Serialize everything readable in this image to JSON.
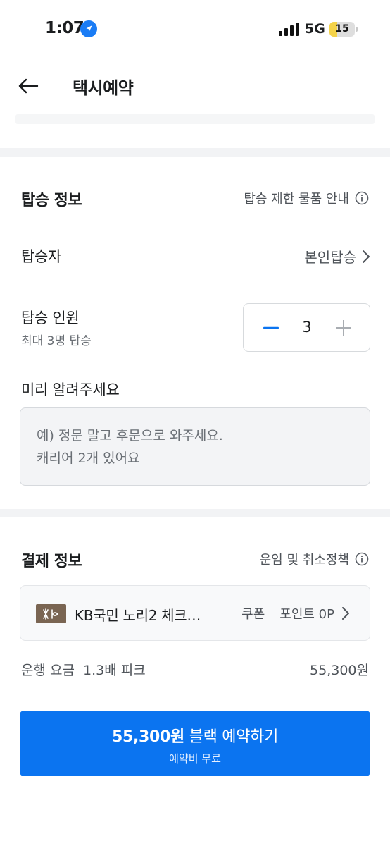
{
  "status_bar": {
    "time": "1:07",
    "network": "5G",
    "battery_level": "15",
    "battery_fraction": 0.15
  },
  "header": {
    "title": "택시예약"
  },
  "boarding_info": {
    "title": "탑승 정보",
    "restricted_items_link": "탑승 제한 물품 안내",
    "passenger_label": "탑승자",
    "passenger_value": "본인탑승",
    "headcount_label": "탑승 인원",
    "headcount_sub": "최대 3명 탑승",
    "headcount_value": "3",
    "memo_label": "미리 알려주세요",
    "memo_placeholder": "예) 정문 말고 후문으로 와주세요.\n캐리어 2개 있어요"
  },
  "payment_info": {
    "title": "결제 정보",
    "policy_link": "운임 및 취소정책",
    "card_name": "KB국민 노리2 체크…",
    "coupon_label": "쿠폰",
    "points_label": "포인트 0P",
    "fare_label": "운행 요금  1.3배 피크",
    "fare_value": "55,300원"
  },
  "cta": {
    "price": "55,300원",
    "action": " 블랙 예약하기",
    "sub": "예약비 무료"
  },
  "colors": {
    "accent": "#0b74f0",
    "stepper_minus": "#0b74f0",
    "card_logo": "#7a6552",
    "battery_fill": "#f4d34a"
  },
  "icons": [
    "location-arrow-icon",
    "signal-icon",
    "battery-icon",
    "back-arrow-icon",
    "info-icon",
    "chevron-right-icon",
    "minus-icon",
    "plus-icon",
    "kb-card-logo-icon"
  ]
}
